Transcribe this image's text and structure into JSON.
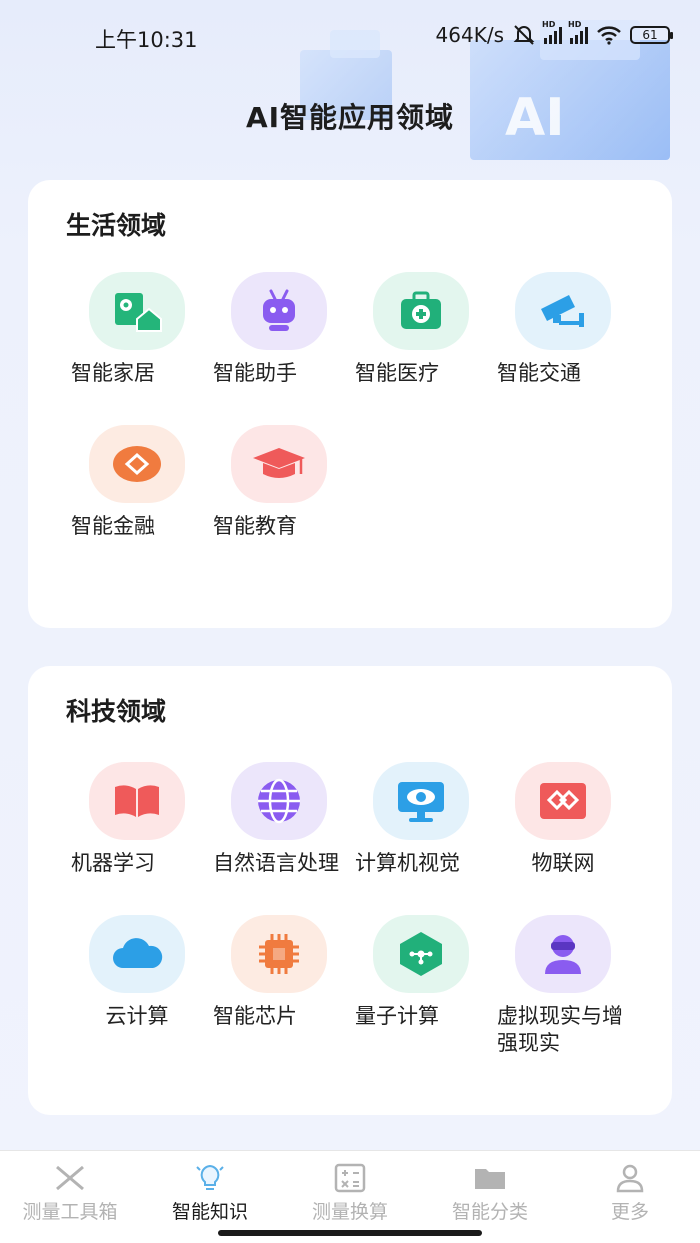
{
  "status_bar": {
    "time": "上午10:31",
    "net_speed": "464K/s",
    "battery": "61"
  },
  "hero": {
    "decor_text": "AI"
  },
  "page_title": "AI智能应用领域",
  "sections": [
    {
      "title": "生活领域",
      "items": [
        {
          "label": "智能家居",
          "icon": "smart-home-icon",
          "bg": "#e3f6ee",
          "color": "#24b57a"
        },
        {
          "label": "智能助手",
          "icon": "robot-icon",
          "bg": "#ece6fb",
          "color": "#8a5cf0"
        },
        {
          "label": "智能医疗",
          "icon": "medical-kit-icon",
          "bg": "#e3f6ee",
          "color": "#21b07a"
        },
        {
          "label": "智能交通",
          "icon": "traffic-camera-icon",
          "bg": "#e3f2fb",
          "color": "#2c9fe6"
        },
        {
          "label": "智能金融",
          "icon": "finance-diamond-icon",
          "bg": "#fdebe2",
          "color": "#f07b3f"
        },
        {
          "label": "智能教育",
          "icon": "graduation-cap-icon",
          "bg": "#fde6e6",
          "color": "#ef5a5a"
        }
      ]
    },
    {
      "title": "科技领域",
      "items": [
        {
          "label": "机器学习",
          "icon": "book-icon",
          "bg": "#fde6e6",
          "color": "#ef5a5a"
        },
        {
          "label": "自然语言处理",
          "icon": "globe-icon",
          "bg": "#ece6fb",
          "color": "#8a5cf0"
        },
        {
          "label": "计算机视觉",
          "icon": "monitor-eye-icon",
          "bg": "#e3f2fb",
          "color": "#2c9fe6"
        },
        {
          "label": "物联网",
          "icon": "iot-link-icon",
          "bg": "#fde6e6",
          "color": "#ef5a5a"
        },
        {
          "label": "云计算",
          "icon": "cloud-icon",
          "bg": "#e3f2fb",
          "color": "#2c9fe6"
        },
        {
          "label": "智能芯片",
          "icon": "chip-icon",
          "bg": "#fdebe2",
          "color": "#f07b3f"
        },
        {
          "label": "量子计算",
          "icon": "quantum-icon",
          "bg": "#e3f6ee",
          "color": "#21b07a"
        },
        {
          "label": "虚拟现实与增强现实",
          "icon": "vr-user-icon",
          "bg": "#ece6fb",
          "color": "#8a5cf0"
        }
      ]
    }
  ],
  "bottom_nav": [
    {
      "label": "测量工具箱",
      "icon": "ruler-pencil-icon",
      "active": false
    },
    {
      "label": "智能知识",
      "icon": "lightbulb-icon",
      "active": true
    },
    {
      "label": "测量换算",
      "icon": "calculator-icon",
      "active": false
    },
    {
      "label": "智能分类",
      "icon": "folder-icon",
      "active": false
    },
    {
      "label": "更多",
      "icon": "person-icon",
      "active": false
    }
  ]
}
